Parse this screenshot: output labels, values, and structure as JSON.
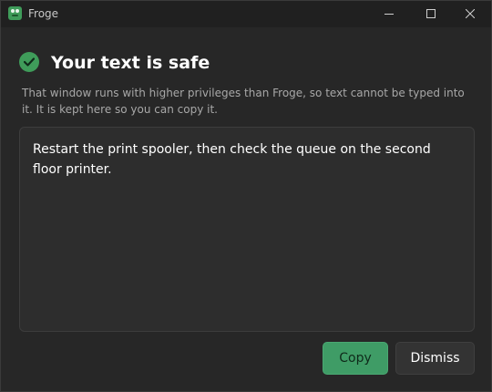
{
  "window": {
    "app_title": "Froge"
  },
  "dialog": {
    "heading": "Your text is safe",
    "description": "That window runs with higher privileges than Froge, so text cannot be typed into it. It is kept here so you can copy it.",
    "text_content": "Restart the print spooler, then check the queue on the second floor printer.",
    "copy_label": "Copy",
    "dismiss_label": "Dismiss"
  },
  "icons": {
    "app": "frog-icon",
    "status": "check-circle-icon",
    "minimize": "minimize-icon",
    "maximize": "maximize-icon",
    "close": "close-icon"
  },
  "colors": {
    "accent": "#3f9c66",
    "background": "#272727",
    "titlebar": "#202020"
  }
}
